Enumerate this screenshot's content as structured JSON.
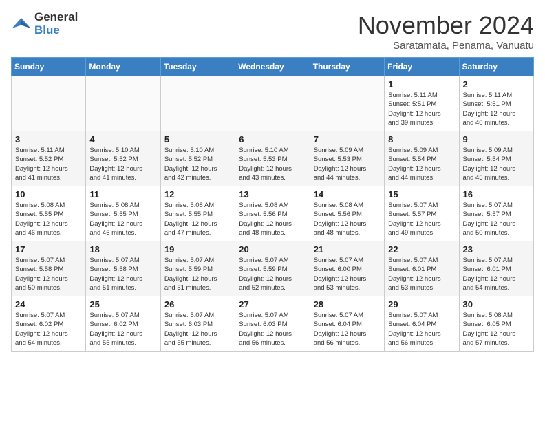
{
  "logo": {
    "line1": "General",
    "line2": "Blue"
  },
  "title": "November 2024",
  "subtitle": "Saratamata, Penama, Vanuatu",
  "days_of_week": [
    "Sunday",
    "Monday",
    "Tuesday",
    "Wednesday",
    "Thursday",
    "Friday",
    "Saturday"
  ],
  "weeks": [
    [
      {
        "day": "",
        "info": ""
      },
      {
        "day": "",
        "info": ""
      },
      {
        "day": "",
        "info": ""
      },
      {
        "day": "",
        "info": ""
      },
      {
        "day": "",
        "info": ""
      },
      {
        "day": "1",
        "info": "Sunrise: 5:11 AM\nSunset: 5:51 PM\nDaylight: 12 hours\nand 39 minutes."
      },
      {
        "day": "2",
        "info": "Sunrise: 5:11 AM\nSunset: 5:51 PM\nDaylight: 12 hours\nand 40 minutes."
      }
    ],
    [
      {
        "day": "3",
        "info": "Sunrise: 5:11 AM\nSunset: 5:52 PM\nDaylight: 12 hours\nand 41 minutes."
      },
      {
        "day": "4",
        "info": "Sunrise: 5:10 AM\nSunset: 5:52 PM\nDaylight: 12 hours\nand 41 minutes."
      },
      {
        "day": "5",
        "info": "Sunrise: 5:10 AM\nSunset: 5:52 PM\nDaylight: 12 hours\nand 42 minutes."
      },
      {
        "day": "6",
        "info": "Sunrise: 5:10 AM\nSunset: 5:53 PM\nDaylight: 12 hours\nand 43 minutes."
      },
      {
        "day": "7",
        "info": "Sunrise: 5:09 AM\nSunset: 5:53 PM\nDaylight: 12 hours\nand 44 minutes."
      },
      {
        "day": "8",
        "info": "Sunrise: 5:09 AM\nSunset: 5:54 PM\nDaylight: 12 hours\nand 44 minutes."
      },
      {
        "day": "9",
        "info": "Sunrise: 5:09 AM\nSunset: 5:54 PM\nDaylight: 12 hours\nand 45 minutes."
      }
    ],
    [
      {
        "day": "10",
        "info": "Sunrise: 5:08 AM\nSunset: 5:55 PM\nDaylight: 12 hours\nand 46 minutes."
      },
      {
        "day": "11",
        "info": "Sunrise: 5:08 AM\nSunset: 5:55 PM\nDaylight: 12 hours\nand 46 minutes."
      },
      {
        "day": "12",
        "info": "Sunrise: 5:08 AM\nSunset: 5:55 PM\nDaylight: 12 hours\nand 47 minutes."
      },
      {
        "day": "13",
        "info": "Sunrise: 5:08 AM\nSunset: 5:56 PM\nDaylight: 12 hours\nand 48 minutes."
      },
      {
        "day": "14",
        "info": "Sunrise: 5:08 AM\nSunset: 5:56 PM\nDaylight: 12 hours\nand 48 minutes."
      },
      {
        "day": "15",
        "info": "Sunrise: 5:07 AM\nSunset: 5:57 PM\nDaylight: 12 hours\nand 49 minutes."
      },
      {
        "day": "16",
        "info": "Sunrise: 5:07 AM\nSunset: 5:57 PM\nDaylight: 12 hours\nand 50 minutes."
      }
    ],
    [
      {
        "day": "17",
        "info": "Sunrise: 5:07 AM\nSunset: 5:58 PM\nDaylight: 12 hours\nand 50 minutes."
      },
      {
        "day": "18",
        "info": "Sunrise: 5:07 AM\nSunset: 5:58 PM\nDaylight: 12 hours\nand 51 minutes."
      },
      {
        "day": "19",
        "info": "Sunrise: 5:07 AM\nSunset: 5:59 PM\nDaylight: 12 hours\nand 51 minutes."
      },
      {
        "day": "20",
        "info": "Sunrise: 5:07 AM\nSunset: 5:59 PM\nDaylight: 12 hours\nand 52 minutes."
      },
      {
        "day": "21",
        "info": "Sunrise: 5:07 AM\nSunset: 6:00 PM\nDaylight: 12 hours\nand 53 minutes."
      },
      {
        "day": "22",
        "info": "Sunrise: 5:07 AM\nSunset: 6:01 PM\nDaylight: 12 hours\nand 53 minutes."
      },
      {
        "day": "23",
        "info": "Sunrise: 5:07 AM\nSunset: 6:01 PM\nDaylight: 12 hours\nand 54 minutes."
      }
    ],
    [
      {
        "day": "24",
        "info": "Sunrise: 5:07 AM\nSunset: 6:02 PM\nDaylight: 12 hours\nand 54 minutes."
      },
      {
        "day": "25",
        "info": "Sunrise: 5:07 AM\nSunset: 6:02 PM\nDaylight: 12 hours\nand 55 minutes."
      },
      {
        "day": "26",
        "info": "Sunrise: 5:07 AM\nSunset: 6:03 PM\nDaylight: 12 hours\nand 55 minutes."
      },
      {
        "day": "27",
        "info": "Sunrise: 5:07 AM\nSunset: 6:03 PM\nDaylight: 12 hours\nand 56 minutes."
      },
      {
        "day": "28",
        "info": "Sunrise: 5:07 AM\nSunset: 6:04 PM\nDaylight: 12 hours\nand 56 minutes."
      },
      {
        "day": "29",
        "info": "Sunrise: 5:07 AM\nSunset: 6:04 PM\nDaylight: 12 hours\nand 56 minutes."
      },
      {
        "day": "30",
        "info": "Sunrise: 5:08 AM\nSunset: 6:05 PM\nDaylight: 12 hours\nand 57 minutes."
      }
    ]
  ]
}
